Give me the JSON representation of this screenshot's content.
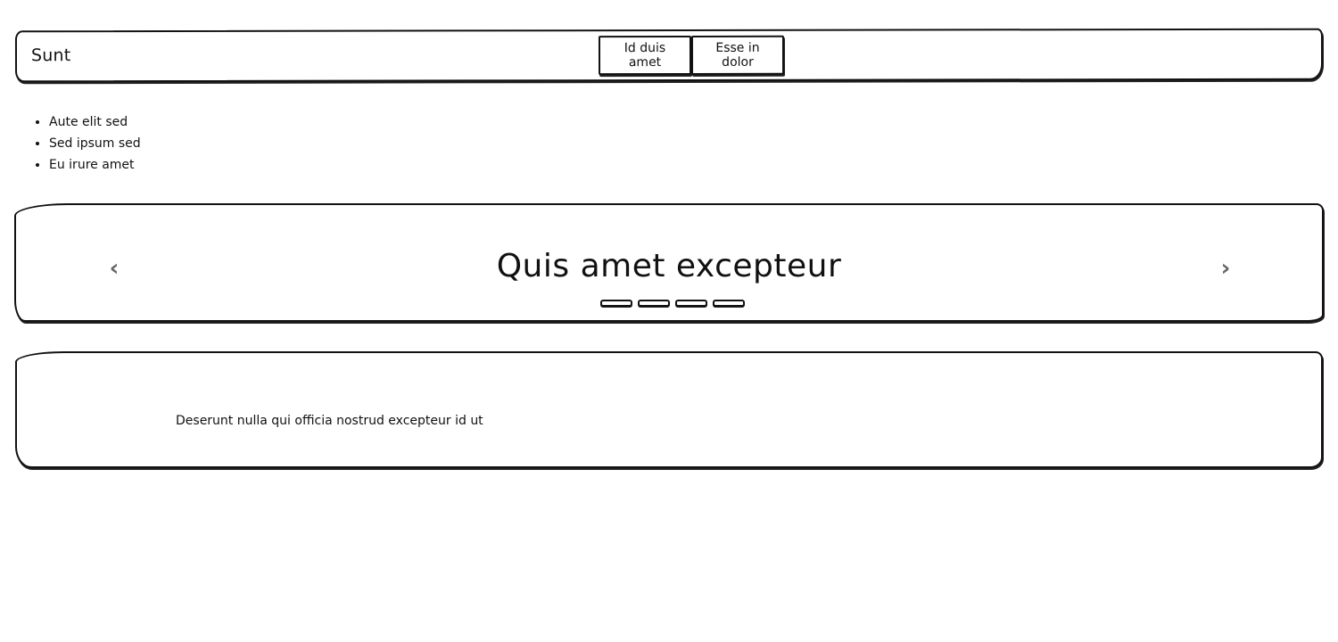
{
  "navbar": {
    "brand": "Sunt",
    "buttons": [
      {
        "label": "Id duis amet"
      },
      {
        "label": "Esse in dolor"
      }
    ]
  },
  "list": {
    "items": [
      "Aute elit sed",
      "Sed ipsum sed",
      "Eu irure amet"
    ]
  },
  "carousel": {
    "title": "Quis amet excepteur",
    "prev_icon": "chevron-left-icon",
    "next_icon": "chevron-right-icon",
    "prev_glyph": "‹",
    "next_glyph": "›",
    "slide_count": 4
  },
  "card": {
    "text": "Deserunt nulla qui officia nostrud excepteur id ut"
  }
}
